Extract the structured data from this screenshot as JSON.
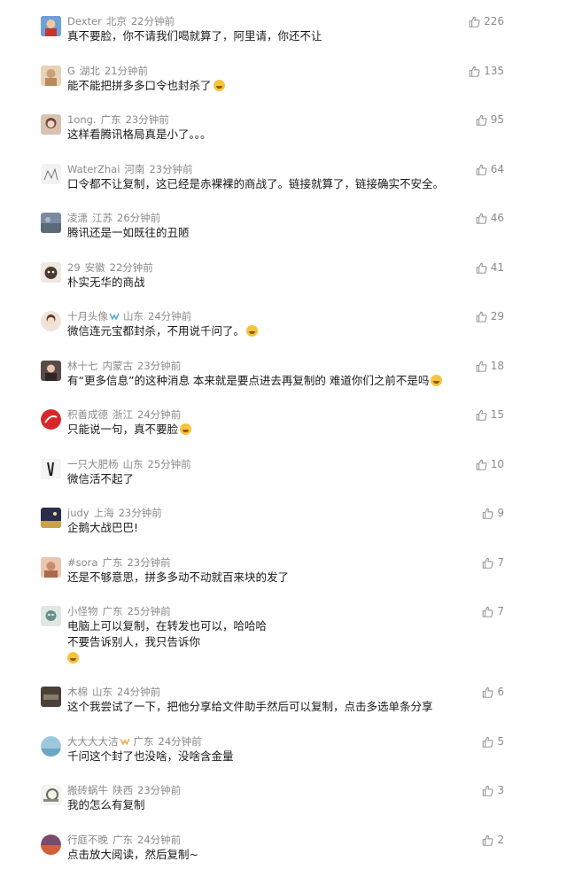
{
  "comments": [
    {
      "nick": "Dexter",
      "loc": "北京",
      "time": "22分钟前",
      "text": "真不要脸，你不请我们喝就算了，阿里请，你还不让",
      "likes": "226",
      "avatar_color": "#3a6fb5",
      "emoji": false
    },
    {
      "nick": "G",
      "loc": "湖北",
      "time": "21分钟前",
      "text": "能不能把拼多多口令也封杀了",
      "likes": "135",
      "avatar_color": "#c9a27a",
      "emoji": true
    },
    {
      "nick": "1ong.",
      "loc": "广东",
      "time": "23分钟前",
      "text": "这样看腾讯格局真是小了。。。",
      "likes": "95",
      "avatar_color": "#6b4a3a",
      "emoji": false
    },
    {
      "nick": "WaterZhai",
      "loc": "河南",
      "time": "23分钟前",
      "text": "口令都不让复制，这已经是赤裸裸的商战了。链接就算了，链接确实不安全。",
      "likes": "64",
      "avatar_color": "#d8d8d8",
      "emoji": false
    },
    {
      "nick": "凌潇",
      "loc": "江苏",
      "time": "26分钟前",
      "text": "腾讯还是一如既往的丑陋",
      "likes": "46",
      "avatar_color": "#7a8ba0",
      "emoji": false
    },
    {
      "nick": "29",
      "loc": "安徽",
      "time": "22分钟前",
      "text": "朴实无华的商战",
      "likes": "41",
      "avatar_color": "#8c7360",
      "emoji": false
    },
    {
      "nick": "十月头像",
      "loc": "山东",
      "time": "24分钟前",
      "text": "微信连元宝都封杀，不用说千问了。",
      "likes": "29",
      "avatar_color": "#e9d3c7",
      "emoji": true
    },
    {
      "nick": "林十七",
      "loc": "内蒙古",
      "time": "23分钟前",
      "text": "有“更多信息”的这种消息 本来就是要点进去再复制的 难道你们之前不是吗",
      "likes": "18",
      "avatar_color": "#5a4b48",
      "emoji": true
    },
    {
      "nick": "积善成德",
      "loc": "浙江",
      "time": "24分钟前",
      "text": "只能说一句，真不要脸",
      "likes": "15",
      "avatar_color": "#d9262b",
      "emoji": true
    },
    {
      "nick": "一只大肥杨",
      "loc": "山东",
      "time": "25分钟前",
      "text": "微信活不起了",
      "likes": "10",
      "avatar_color": "#444444",
      "emoji": false
    },
    {
      "nick": "judy",
      "loc": "上海",
      "time": "23分钟前",
      "text": "企鹅大战巴巴!",
      "likes": "9",
      "avatar_color": "#3b3a55",
      "emoji": false
    },
    {
      "nick": "#sora",
      "loc": "广东",
      "time": "23分钟前",
      "text": "还是不够意思，拼多多动不动就百来块的发了",
      "likes": "7",
      "avatar_color": "#c98c6a",
      "emoji": false
    },
    {
      "nick": "小怪物",
      "loc": "广东",
      "time": "25分钟前",
      "text": "电脑上可以复制，在转发也可以，哈哈哈",
      "text2": "不要告诉别人，我只告诉你",
      "likes": "7",
      "avatar_color": "#6a8f8a",
      "emoji": false
    },
    {
      "nick": "木棉",
      "loc": "山东",
      "time": "24分钟前",
      "text": "这个我尝试了一下，把他分享给文件助手然后可以复制，点击多选单条分享",
      "likes": "6",
      "avatar_color": "#4a4038",
      "emoji": false
    },
    {
      "nick": "大大大大洁",
      "loc": "广东",
      "time": "24分钟前",
      "text": "千问这个封了也没啥，没啥含金量",
      "likes": "5",
      "avatar_color": "#9cc8dc",
      "emoji": false
    },
    {
      "nick": "搬砖蜗牛",
      "loc": "陕西",
      "time": "23分钟前",
      "text": "我的怎么有复制",
      "likes": "3",
      "avatar_color": "#8a8a7a",
      "emoji": false
    },
    {
      "nick": "行庭不晚",
      "loc": "广东",
      "time": "24分钟前",
      "text": "点击放大阅读，然后复制~",
      "likes": "2",
      "avatar_color": "#7c4a6a",
      "emoji": false
    }
  ]
}
